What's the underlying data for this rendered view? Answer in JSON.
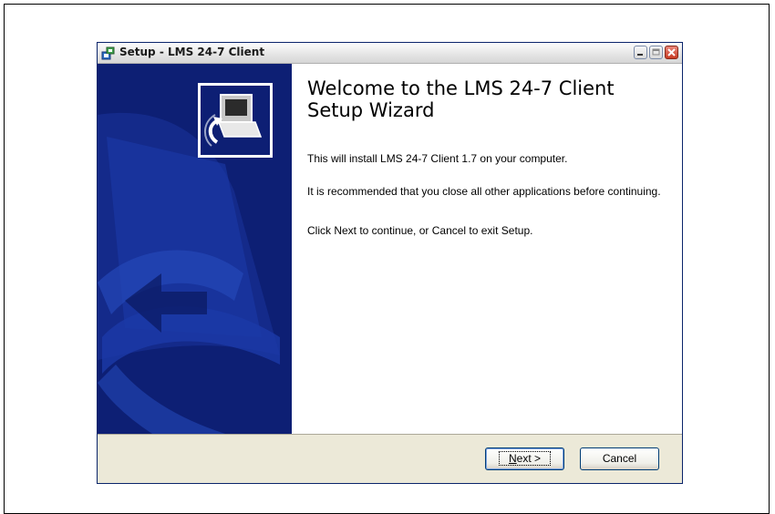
{
  "window": {
    "title": "Setup - LMS 24-7 Client"
  },
  "welcome": {
    "heading": "Welcome to the LMS 24-7 Client\nSetup Wizard",
    "paragraph_1": "This will install LMS 24-7 Client 1.7 on your computer.",
    "paragraph_2": "It is recommended that you close all other applications before continuing.",
    "paragraph_3": "Click Next to continue, or Cancel to exit Setup."
  },
  "buttons": {
    "next_label": "Next >",
    "cancel_label": "Cancel"
  },
  "colors": {
    "sidebar_background": "#0d1f74",
    "sidebar_art": "#1b3aa8",
    "content_background": "#ffffff",
    "dialog_face": "#ece9d8"
  },
  "icons": {
    "app": "setup-installer-icon",
    "wizard_logo": "computer-install-icon"
  }
}
